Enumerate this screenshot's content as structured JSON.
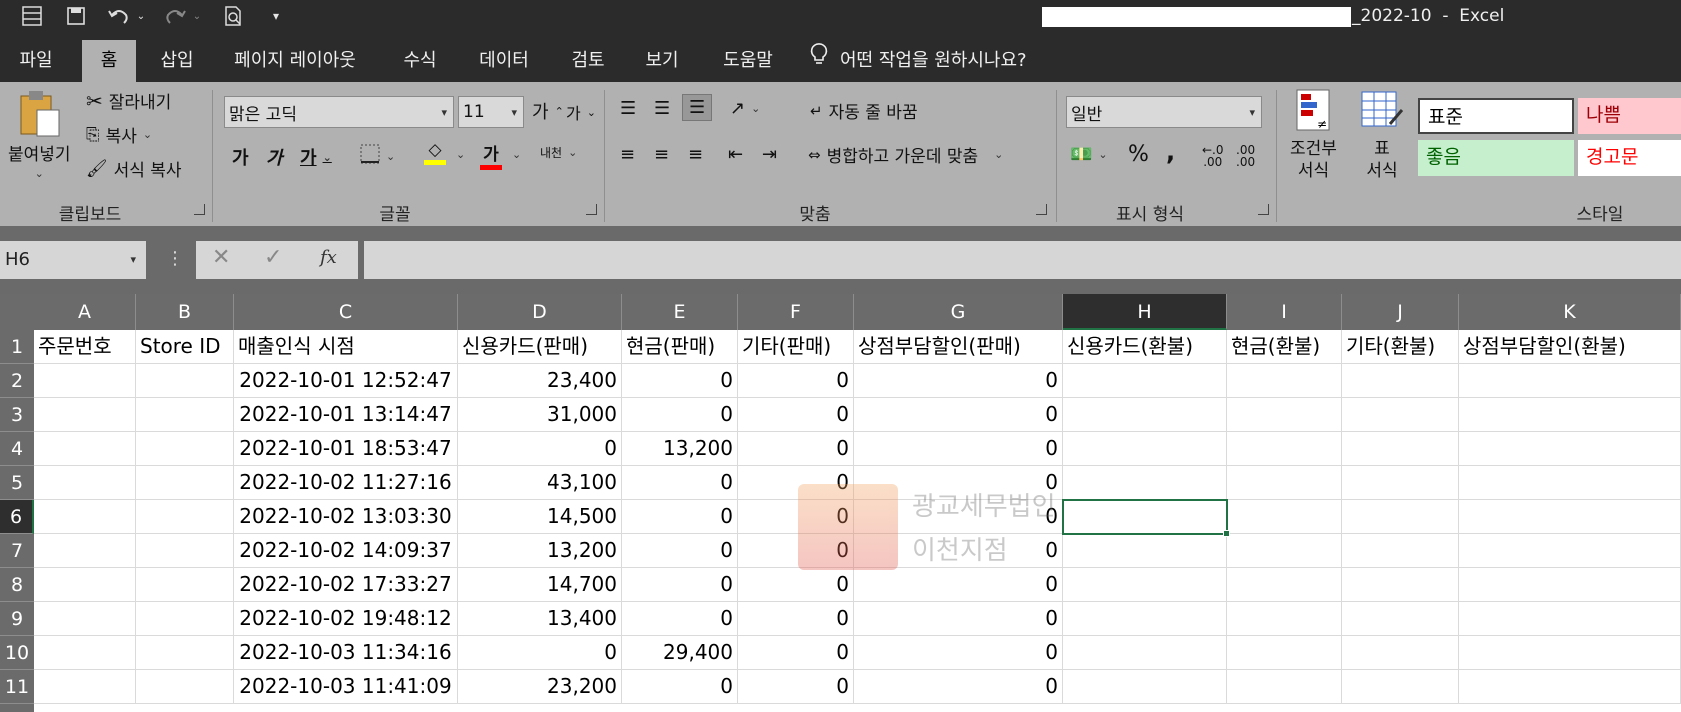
{
  "titlebar": {
    "title_suffix": "_2022-10  -  Excel"
  },
  "tabs": [
    {
      "label": "파일",
      "name": "tab-file"
    },
    {
      "label": "홈",
      "name": "tab-home"
    },
    {
      "label": "삽입",
      "name": "tab-insert"
    },
    {
      "label": "페이지 레이아웃",
      "name": "tab-page-layout"
    },
    {
      "label": "수식",
      "name": "tab-formulas"
    },
    {
      "label": "데이터",
      "name": "tab-data"
    },
    {
      "label": "검토",
      "name": "tab-review"
    },
    {
      "label": "보기",
      "name": "tab-view"
    },
    {
      "label": "도움말",
      "name": "tab-help"
    }
  ],
  "tell_me": "어떤 작업을 원하시나요?",
  "ribbon": {
    "clipboard": {
      "paste": "붙여넣기",
      "cut": "잘라내기",
      "copy": "복사",
      "format_painter": "서식 복사",
      "label": "클립보드"
    },
    "font": {
      "font_name": "맑은 고딕",
      "font_size": "11",
      "grow": "가",
      "shrink": "가",
      "bold": "가",
      "italic": "가",
      "underline": "가",
      "font_color": "가",
      "phonetic": "내천",
      "label": "글꼴"
    },
    "alignment": {
      "wrap": "자동 줄 바꿈",
      "merge": "병합하고 가운데 맞춤",
      "label": "맞춤"
    },
    "number": {
      "format": "일반",
      "percent": "%",
      "comma": ",",
      "inc_decimal": ".00",
      "dec_decimal": ".00",
      "label": "표시 형식"
    },
    "styles": {
      "conditional_1": "조건부",
      "conditional_2": "서식",
      "table_1": "표",
      "table_2": "서식",
      "normal": "표준",
      "bad": "나쁨",
      "good": "좋음",
      "warning": "경고문",
      "label": "스타일"
    }
  },
  "formula_bar": {
    "name_box": "H6",
    "fx": "fx",
    "value": ""
  },
  "columns": [
    "A",
    "B",
    "C",
    "D",
    "E",
    "F",
    "G",
    "H",
    "I",
    "J",
    "K"
  ],
  "rows": [
    "1",
    "2",
    "3",
    "4",
    "5",
    "6",
    "7",
    "8",
    "9",
    "10",
    "11"
  ],
  "header_row": [
    "주문번호",
    "Store ID",
    "매출인식 시점",
    "신용카드(판매)",
    "현금(판매)",
    "기타(판매)",
    "상점부담할인(판매)",
    "신용카드(환불)",
    "현금(환불)",
    "기타(환불)",
    "상점부담할인(환불)"
  ],
  "data_rows": [
    [
      "",
      "",
      "2022-10-01 12:52:47",
      "23,400",
      "0",
      "0",
      "0"
    ],
    [
      "",
      "",
      "2022-10-01 13:14:47",
      "31,000",
      "0",
      "0",
      "0"
    ],
    [
      "",
      "",
      "2022-10-01 18:53:47",
      "0",
      "13,200",
      "0",
      "0"
    ],
    [
      "",
      "",
      "2022-10-02 11:27:16",
      "43,100",
      "0",
      "0",
      "0"
    ],
    [
      "",
      "",
      "2022-10-02 13:03:30",
      "14,500",
      "0",
      "0",
      "0"
    ],
    [
      "",
      "",
      "2022-10-02 14:09:37",
      "13,200",
      "0",
      "0",
      "0"
    ],
    [
      "",
      "",
      "2022-10-02 17:33:27",
      "14,700",
      "0",
      "0",
      "0"
    ],
    [
      "",
      "",
      "2022-10-02 19:48:12",
      "13,400",
      "0",
      "0",
      "0"
    ],
    [
      "",
      "",
      "2022-10-03 11:34:16",
      "0",
      "29,400",
      "0",
      "0"
    ],
    [
      "",
      "",
      "2022-10-03 11:41:09",
      "23,200",
      "0",
      "0",
      "0"
    ]
  ],
  "selected_cell": "H6",
  "watermark": {
    "line1": "광교세무법인",
    "line2": "이천지점"
  },
  "colors": {
    "accent": "#217346",
    "bad_bg": "#ffc7ce",
    "bad_fg": "#9c0006",
    "good_bg": "#c6efce",
    "good_fg": "#006100",
    "warning_fg": "#ff0000"
  }
}
